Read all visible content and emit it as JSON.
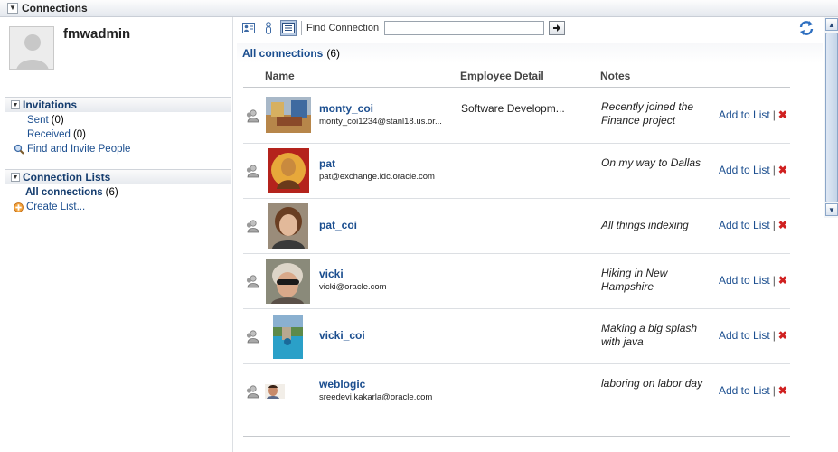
{
  "window": {
    "title": "Connections"
  },
  "profile": {
    "username": "fmwadmin"
  },
  "invitations": {
    "title": "Invitations",
    "sent_label": "Sent",
    "sent_count": "(0)",
    "received_label": "Received",
    "received_count": "(0)",
    "find_invite_label": "Find and Invite People"
  },
  "connection_lists": {
    "title": "Connection Lists",
    "all_label": "All connections",
    "all_count": "(6)",
    "create_label": "Create List..."
  },
  "toolbar": {
    "find_label": "Find Connection",
    "find_value": ""
  },
  "list": {
    "title": "All connections",
    "count": "(6)",
    "columns": {
      "name": "Name",
      "detail": "Employee Detail",
      "notes": "Notes"
    },
    "add_label": "Add to List",
    "separator": "|",
    "rows": [
      {
        "name": "monty_coi",
        "email": "monty_coi1234@stanl18.us.or...",
        "detail": "Software Developm...",
        "note": "Recently joined the Finance project"
      },
      {
        "name": "pat",
        "email": "pat@exchange.idc.oracle.com",
        "detail": "",
        "note": "On my way to Dallas"
      },
      {
        "name": "pat_coi",
        "email": "",
        "detail": "",
        "note": "All things indexing"
      },
      {
        "name": "vicki",
        "email": "vicki@oracle.com",
        "detail": "",
        "note": "Hiking in New Hampshire"
      },
      {
        "name": "vicki_coi",
        "email": "",
        "detail": "",
        "note": "Making a big splash with java"
      },
      {
        "name": "weblogic",
        "email": "sreedevi.kakarla@oracle.com",
        "detail": "",
        "note": "laboring on labor day"
      }
    ]
  },
  "colors": {
    "link": "#1b4e8f",
    "delete": "#d02020",
    "accent": "#143c6e"
  }
}
